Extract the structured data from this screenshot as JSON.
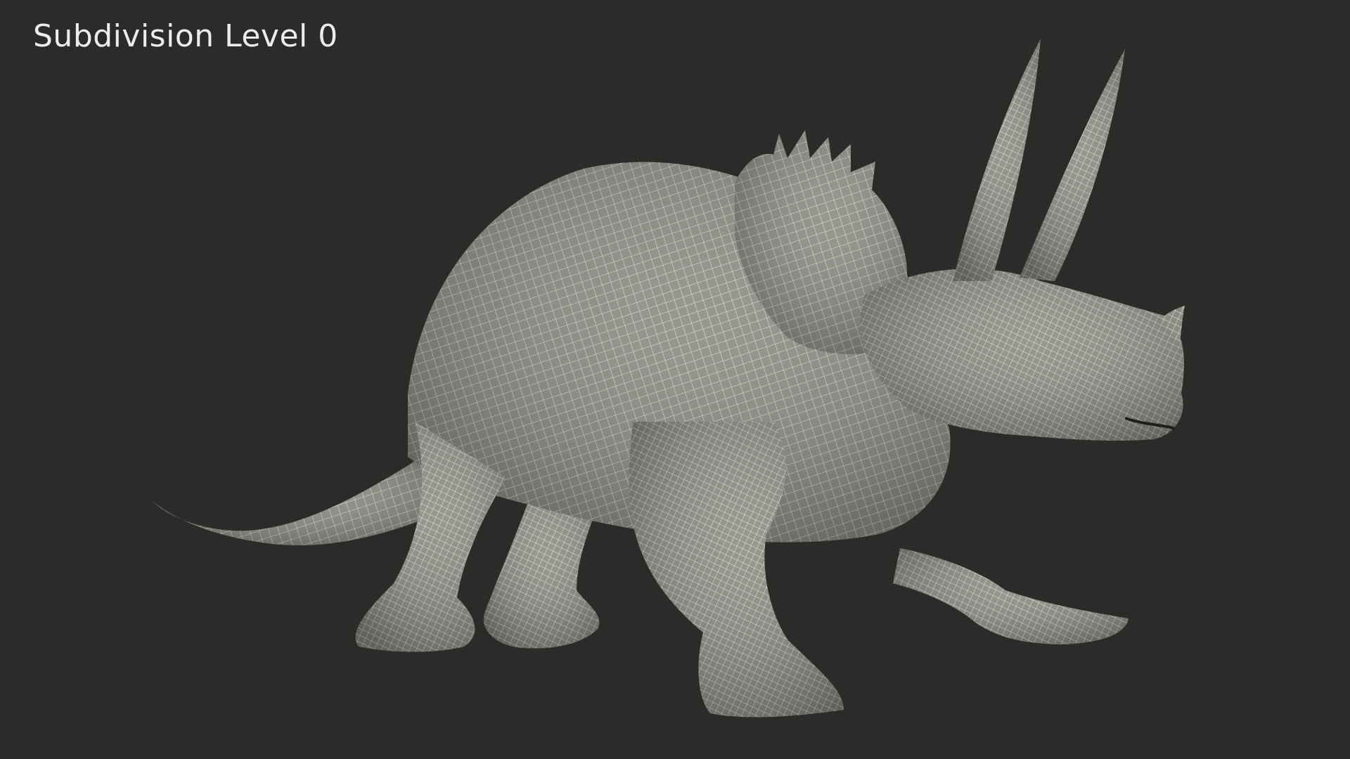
{
  "viewport": {
    "label": "Subdivision Level 0",
    "background": "#2b2b2a"
  },
  "model": {
    "subject": "triceratops-wireframe",
    "shade_color": "#8e8f86",
    "wire_color": "#ecedde"
  }
}
